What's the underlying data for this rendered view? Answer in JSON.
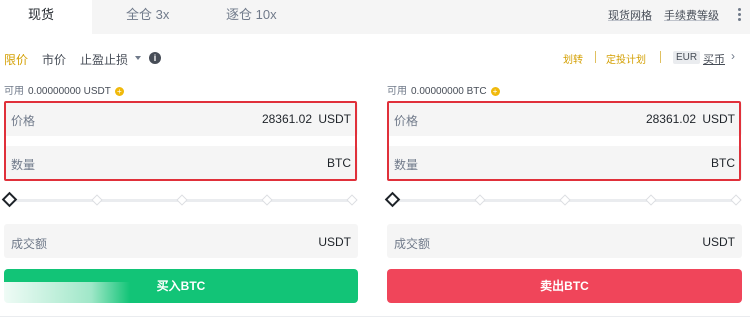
{
  "tabs": {
    "spot": "现货",
    "cross": "全仓 3x",
    "isolated": "逐仓 10x"
  },
  "top_links": {
    "spot_grid": "现货网格",
    "fee_level": "手续费等级"
  },
  "order_types": {
    "limit": "限价",
    "market": "市价",
    "stop_limit": "止盈止损"
  },
  "right_links": {
    "transfer": "划转",
    "recurring_plan": "定投计划",
    "currency": "EUR",
    "buy_coin": "买币",
    "chevron": "›"
  },
  "buy_panel": {
    "avail_label": "可用",
    "avail_value": "0.00000000 USDT",
    "price_label": "价格",
    "price_value": "28361.02",
    "price_unit": "USDT",
    "qty_label": "数量",
    "qty_unit": "BTC",
    "slider_percent": 0,
    "total_label": "成交额",
    "total_unit": "USDT",
    "button_label": "买入BTC",
    "button_color": "#12c477"
  },
  "sell_panel": {
    "avail_label": "可用",
    "avail_value": "0.00000000 BTC",
    "price_label": "价格",
    "price_value": "28361.02",
    "price_unit": "USDT",
    "qty_label": "数量",
    "qty_unit": "BTC",
    "slider_percent": 0,
    "total_label": "成交额",
    "total_unit": "USDT",
    "button_label": "卖出BTC",
    "button_color": "#f0455a"
  },
  "colors": {
    "accent": "#d4a004",
    "highlight_border": "#e0303a"
  }
}
